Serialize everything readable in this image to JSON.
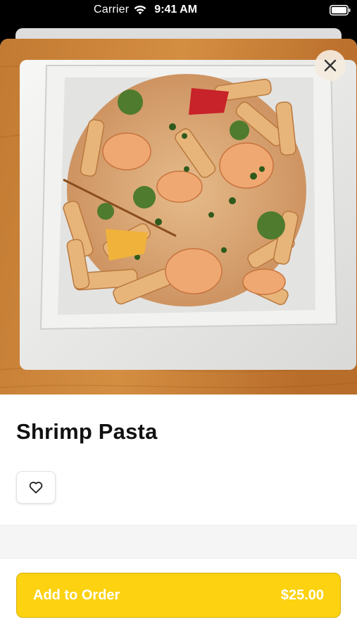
{
  "status_bar": {
    "carrier": "Carrier",
    "time": "9:41 AM",
    "wifi_icon": "wifi-icon",
    "battery_icon": "battery-icon"
  },
  "item": {
    "image_description_icon": "food-photo",
    "name": "Shrimp Pasta",
    "favorite_icon": "heart-icon",
    "close_icon": "close-icon"
  },
  "order": {
    "button_label": "Add to Order",
    "price": "$25.00"
  },
  "colors": {
    "accent": "#fcd211",
    "title": "#111111",
    "background": "#ffffff"
  }
}
